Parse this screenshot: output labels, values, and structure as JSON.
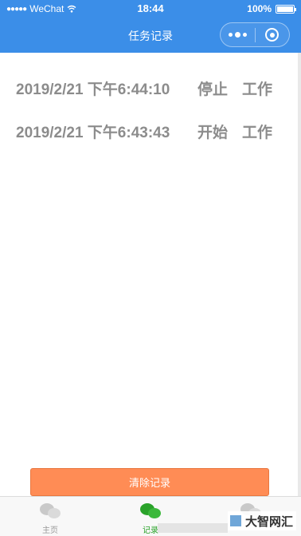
{
  "status_bar": {
    "signal": "●●●●●",
    "carrier": "WeChat",
    "wifi_icon": "wifi-icon",
    "time": "18:44",
    "battery_percent": "100%",
    "battery_level": 1.0
  },
  "nav": {
    "title": "任务记录",
    "more_icon": "more-dots-icon",
    "close_icon": "target-close-icon"
  },
  "records": [
    {
      "datetime": "2019/2/21 下午6:44:10",
      "action": "停止",
      "type": "工作"
    },
    {
      "datetime": "2019/2/21 下午6:43:43",
      "action": "开始",
      "type": "工作"
    }
  ],
  "clear_button": {
    "label": "清除记录",
    "color": "#ff8c55"
  },
  "tabbar": {
    "tabs": [
      {
        "label": "主页",
        "icon": "chat-bubbles-icon",
        "active": false
      },
      {
        "label": "记录",
        "icon": "chat-bubbles-icon",
        "active": true
      },
      {
        "label": "",
        "icon": "chat-bubbles-icon",
        "active": false
      }
    ],
    "active_color": "#2aa22a"
  },
  "watermark": {
    "text": "大智网汇"
  },
  "colors": {
    "header": "#3b8ee8",
    "record_text": "#8c8c8c"
  }
}
